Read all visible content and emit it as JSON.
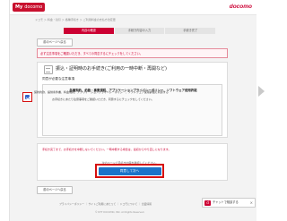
{
  "header": {
    "logo_prefix": "My",
    "logo_text": "docomo",
    "brand": "docomo"
  },
  "breadcrumb": "ドコモ ＞ 料金・割引 ＞ 各種手続き ＞ ご利用料金の支払方法変更",
  "steps": [
    {
      "label": "内容の確認"
    },
    {
      "label": "手続き内容の入力"
    },
    {
      "label": "手続き完了"
    }
  ],
  "back_label": "前のページへ戻る",
  "alert_text": "必ず注意事項をご確認いただき、すべての同意するにチェックをしてください。",
  "service": {
    "title": "振込・証明時のお手続き(ご利用の一時中断・再開など)"
  },
  "terms": {
    "heading": "同意が必要な注意事項",
    "title": "各種契約、約款・事業規程、アプリケーションプライバシーポリシー、ソフトウェア使用許諾",
    "description": "お手続きにあたり注意事項をご確認いただき、同意するにチェックをしてください。"
  },
  "agree": {
    "checked": true,
    "text": "契約約款、提供条件書、料金規約、アプリケーションプライバシーポリシー、ソフトウェア使用許諾に同意する"
  },
  "notice": {
    "red_text": "手続き完了まで、お手続きを中断しないでください。一時中断する場合は、最初からやり直しになります。",
    "sub_text": "次のページで手続き内容を確認してください。"
  },
  "next_button": "同意して次へ",
  "back_label_bottom": "前のページへ戻る",
  "footer": {
    "links": "プライバシーポリシー ｜ サイトご利用にあたって ｜ ドコモについて ｜ 企業情報",
    "copyright": "© NTT DOCOMO, INC. All Rights Reserved."
  },
  "chat": {
    "badge": "d",
    "label": "チャットで相談する",
    "close": "×"
  },
  "colors": {
    "brand_red": "#cc0033",
    "highlight_red": "#d50f0f",
    "button_blue": "#1a73c9"
  }
}
